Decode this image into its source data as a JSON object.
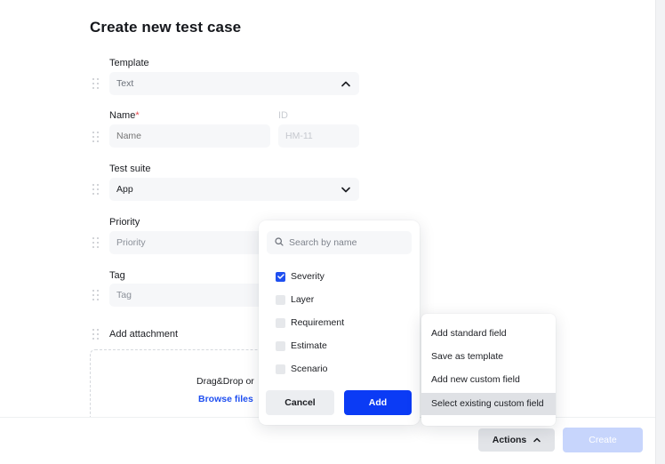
{
  "page": {
    "title": "Create new test case"
  },
  "form": {
    "template": {
      "label": "Template",
      "value": "Text"
    },
    "name": {
      "label": "Name",
      "required_mark": "*",
      "placeholder": "Name"
    },
    "id": {
      "label": "ID",
      "value": "HM-11"
    },
    "test_suite": {
      "label": "Test suite",
      "value": "App"
    },
    "priority": {
      "label": "Priority",
      "placeholder": "Priority"
    },
    "tag": {
      "label": "Tag",
      "placeholder": "Tag"
    },
    "attachment": {
      "label": "Add attachment",
      "drop_text": "Drag&Drop or",
      "browse_link": "Browse files"
    }
  },
  "field_picker": {
    "search_placeholder": "Search by name",
    "options": [
      {
        "label": "Severity",
        "checked": true
      },
      {
        "label": "Layer",
        "checked": false
      },
      {
        "label": "Requirement",
        "checked": false
      },
      {
        "label": "Estimate",
        "checked": false
      },
      {
        "label": "Scenario",
        "checked": false
      }
    ],
    "cancel_label": "Cancel",
    "add_label": "Add"
  },
  "actions_menu": {
    "items": [
      {
        "label": "Add standard field",
        "active": false
      },
      {
        "label": "Save as template",
        "active": false
      },
      {
        "label": "Add new custom field",
        "active": false
      },
      {
        "label": "Select existing custom field",
        "active": true
      }
    ]
  },
  "footer": {
    "actions_label": "Actions",
    "create_label": "Create"
  },
  "colors": {
    "accent": "#0b3bf5",
    "link": "#1f4ff0",
    "required": "#e5484d",
    "disabled_button": "#c7d5fc"
  }
}
